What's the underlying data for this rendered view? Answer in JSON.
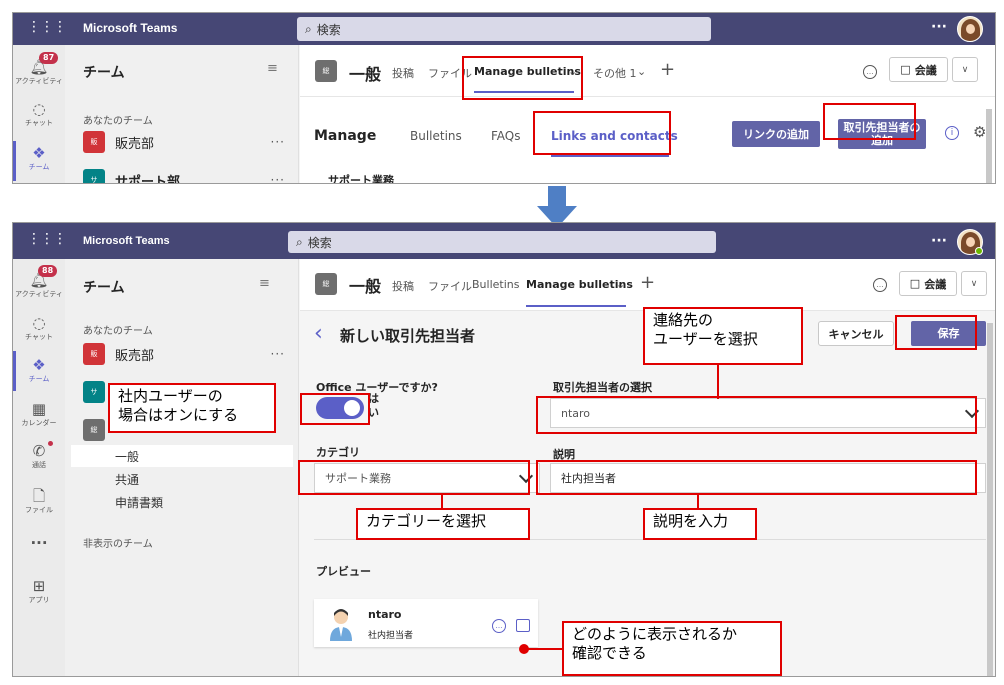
{
  "top_shot": {
    "app_title": "Microsoft Teams",
    "search_placeholder": "検索",
    "more": "···",
    "rail": [
      {
        "label": "アクティビティ",
        "badge": "87",
        "icon": "bell-icon"
      },
      {
        "label": "チャット",
        "icon": "chat-icon"
      },
      {
        "label": "チーム",
        "icon": "teams-icon"
      }
    ],
    "pane_title": "チーム",
    "section": "あなたのチーム",
    "teams": [
      {
        "name": "販売部",
        "abbr": "販",
        "color": "#d13438"
      },
      {
        "name": "サポート部",
        "abbr": "サ",
        "color": "#038387"
      }
    ],
    "team_more": "···",
    "channel": {
      "abbr": "総",
      "name": "一般"
    },
    "tabs": [
      "投稿",
      "ファイル",
      "Manage bulletins",
      "その他 1"
    ],
    "add_tab": "+",
    "meet_label": "会議",
    "sub_tabs": [
      "Manage",
      "Bulletins",
      "FAQs",
      "Links and contacts"
    ],
    "add_link_button": "リンクの追加",
    "add_contact_button_line1": "取引先担当者の",
    "add_contact_button_line2": "追加",
    "section_heading": "サポート業務"
  },
  "bottom_shot": {
    "app_title": "Microsoft Teams",
    "search_placeholder": "検索",
    "more": "···",
    "rail": [
      {
        "label": "アクティビティ",
        "badge": "88",
        "icon": "bell-icon"
      },
      {
        "label": "チャット",
        "icon": "chat-icon"
      },
      {
        "label": "チーム",
        "icon": "teams-icon"
      },
      {
        "label": "カレンダー",
        "icon": "calendar-icon"
      },
      {
        "label": "通話",
        "icon": "phone-icon"
      },
      {
        "label": "ファイル",
        "icon": "file-icon"
      },
      {
        "label": "···",
        "icon": "more-apps-icon"
      },
      {
        "label": "アプリ",
        "icon": "apps-icon"
      }
    ],
    "pane_title": "チーム",
    "section": "あなたのチーム",
    "teams": [
      {
        "name": "販売部",
        "abbr": "販",
        "color": "#d13438"
      },
      {
        "name": "サ",
        "abbr": "サ",
        "color": "#038387"
      },
      {
        "name": "総",
        "abbr": "総",
        "color": "#6e6e6e"
      }
    ],
    "team_more": "···",
    "channels": [
      "一般",
      "共通",
      "申請書類"
    ],
    "hidden_teams": "非表示のチーム",
    "channel": {
      "abbr": "総",
      "name": "一般"
    },
    "tabs": [
      "投稿",
      "ファイル",
      "Bulletins",
      "Manage bulletins"
    ],
    "add_tab": "+",
    "meet_label": "会議",
    "form_title": "新しい取引先担当者",
    "cancel_button": "キャンセル",
    "save_button": "保存",
    "office_user_label": "Office ユーザーですか?",
    "toggle_value": "はい",
    "toggle_on": true,
    "contact_select_label": "取引先担当者の選択",
    "contact_select_value": "ntaro",
    "category_label": "カテゴリ",
    "category_value": "サポート業務",
    "description_label": "説明",
    "description_value": "社内担当者",
    "preview_label": "プレビュー",
    "preview_card": {
      "name": "ntaro",
      "description": "社内担当者"
    }
  },
  "callouts": {
    "internal_user": "社内ユーザーの\n場合はオンにする",
    "select_contact": "連絡先の\nユーザーを選択",
    "select_category": "カテゴリーを選択",
    "enter_description": "説明を入力",
    "preview_check": "どのように表示されるか\n確認できる"
  },
  "colors": {
    "titlebar": "#464775",
    "accent": "#6264a7",
    "annotation_red": "#e00000",
    "arrow_blue": "#4f7fc5"
  }
}
